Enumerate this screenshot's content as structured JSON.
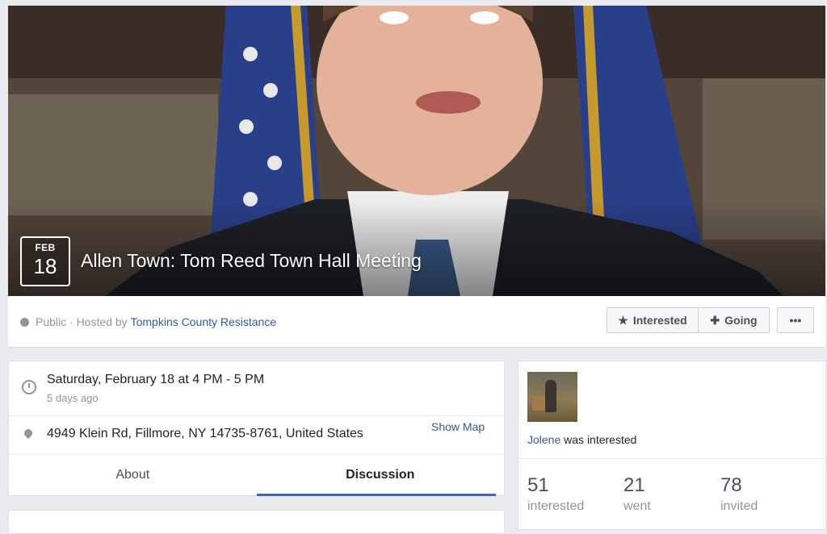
{
  "event": {
    "month": "FEB",
    "day": "18",
    "title": "Allen Town: Tom Reed Town Hall Meeting",
    "privacy": "Public · Hosted by",
    "host": "Tompkins County Resistance"
  },
  "actions": {
    "interested_label": "Interested",
    "going_label": "Going",
    "more_label": "•••"
  },
  "details": {
    "when": "Saturday, February 18 at 4 PM - 5 PM",
    "ago": "5 days ago",
    "address": "4949 Klein Rd, Fillmore, NY 14735-8761, United States",
    "show_map": "Show Map"
  },
  "tabs": [
    {
      "label": "About"
    },
    {
      "label": "Discussion"
    }
  ],
  "activity": {
    "user": "Jolene",
    "action": " was interested"
  },
  "stats": [
    {
      "value": "51",
      "label": "interested"
    },
    {
      "value": "21",
      "label": "went"
    },
    {
      "value": "78",
      "label": "invited"
    }
  ]
}
